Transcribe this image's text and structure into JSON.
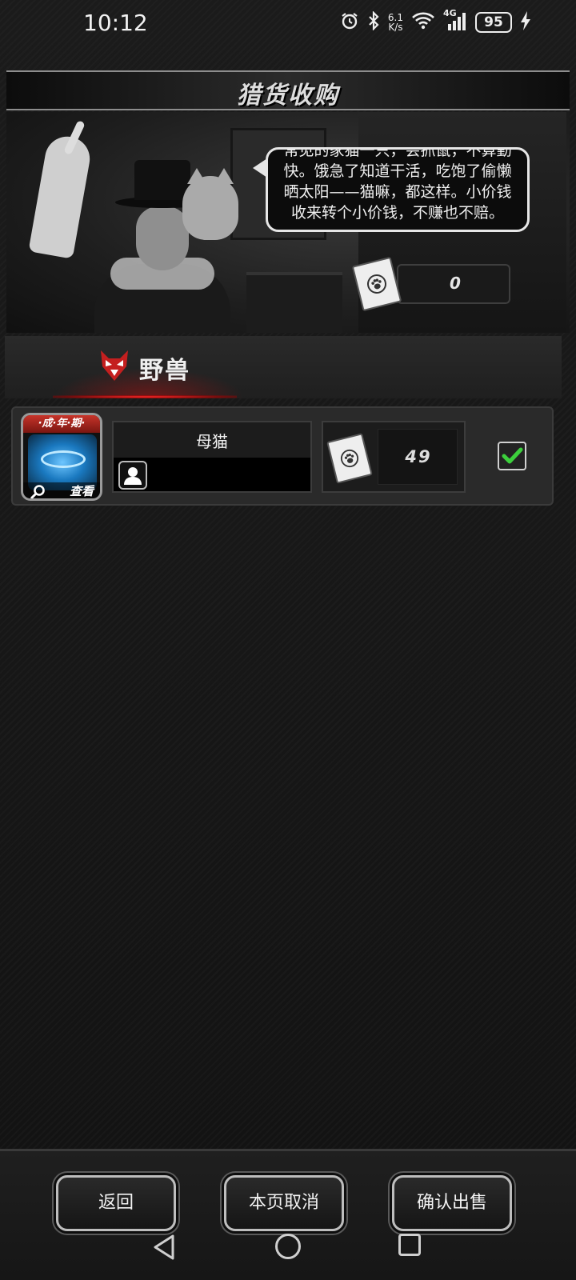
{
  "status_bar": {
    "time": "10:12",
    "net_speed_value": "6.1",
    "net_speed_unit": "K/s",
    "network": "4G",
    "battery": "95",
    "icons": [
      "alarm-icon",
      "bluetooth-icon",
      "wifi-icon",
      "signal-icon",
      "battery-icon",
      "charging-icon"
    ]
  },
  "header": {
    "title": "猎货收购"
  },
  "merchant": {
    "speech": "常见的家猫一只，会抓鼠，不算勤快。饿急了知道干活，吃饱了偷懒晒太阳——猫嘛，都这样。小价钱收来转个小价钱，不赚也不赔。",
    "currency_value": "0"
  },
  "category": {
    "label": "野兽",
    "icon": "wolf-icon",
    "accent": "#c41f1f"
  },
  "items": [
    {
      "stage": "·成·年·期·",
      "view_label": "查看",
      "name": "母猫",
      "price": "49",
      "selected": true
    }
  ],
  "actions": {
    "back": "返回",
    "cancel_page": "本页取消",
    "confirm_sell": "确认出售"
  },
  "colors": {
    "check": "#3ccf3c",
    "border": "#bdbdbd"
  }
}
